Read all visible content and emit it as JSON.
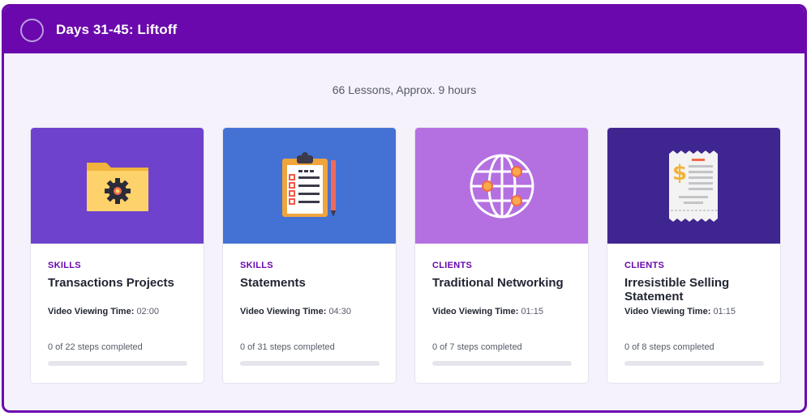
{
  "module": {
    "title": "Days 31-45: Liftoff",
    "summary": "66 Lessons, Approx. 9 hours"
  },
  "colors": {
    "header": "#6a08ad",
    "panel_background": "#f5f2fc",
    "category_text": "#6a08ad"
  },
  "cards": [
    {
      "category": "SKILLS",
      "title": "Transactions Projects",
      "viewing_label": "Video Viewing Time:",
      "viewing_time": "02:00",
      "steps": "0 of 22 steps completed",
      "progress": 0,
      "thumb_color": "#6e42cc",
      "icon": "folder-gear-icon"
    },
    {
      "category": "SKILLS",
      "title": "Statements",
      "viewing_label": "Video Viewing Time:",
      "viewing_time": "04:30",
      "steps": "0 of 31 steps completed",
      "progress": 0,
      "thumb_color": "#4472d4",
      "icon": "clipboard-icon"
    },
    {
      "category": "CLIENTS",
      "title": "Traditional Networking",
      "viewing_label": "Video Viewing Time:",
      "viewing_time": "01:15",
      "steps": "0 of 7 steps completed",
      "progress": 0,
      "thumb_color": "#b470e0",
      "icon": "globe-network-icon"
    },
    {
      "category": "CLIENTS",
      "title": "Irresistible Selling Statement",
      "viewing_label": "Video Viewing Time:",
      "viewing_time": "01:15",
      "steps": "0 of 8 steps completed",
      "progress": 0,
      "thumb_color": "#3f2590",
      "icon": "receipt-icon"
    }
  ]
}
